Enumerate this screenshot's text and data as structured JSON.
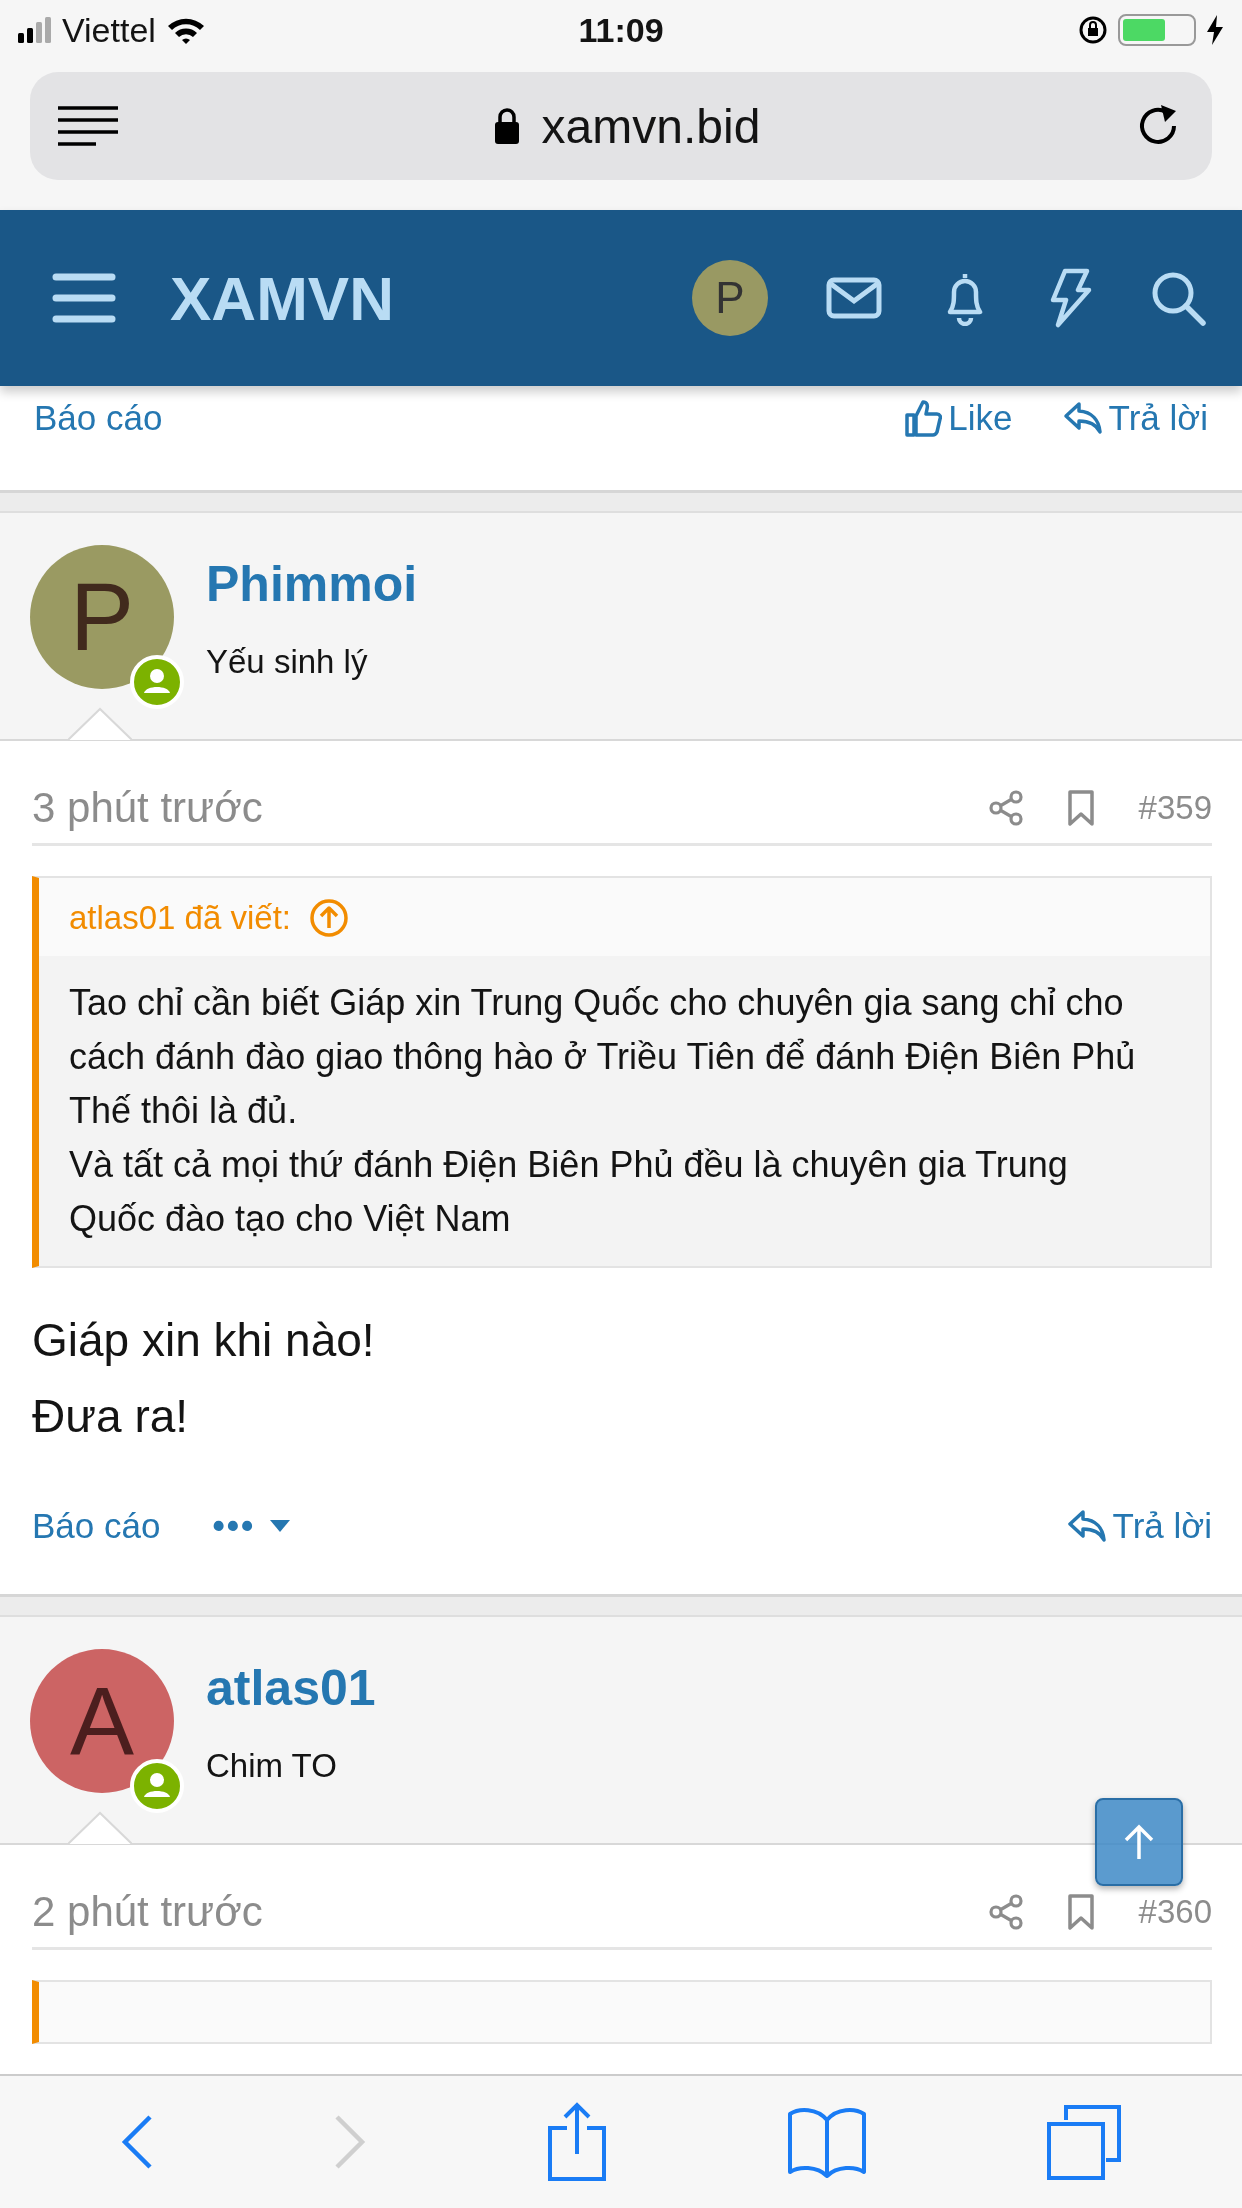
{
  "status_bar": {
    "carrier": "Viettel",
    "time": "11:09"
  },
  "browser": {
    "url": "xamvn.bid"
  },
  "site_header": {
    "logo": "XAMVN",
    "avatar_letter": "P"
  },
  "prev_post_actions": {
    "report": "Báo cáo",
    "like": "Like",
    "reply": "Trả lời"
  },
  "posts": [
    {
      "author": "Phimmoi",
      "user_title": "Yếu sinh lý",
      "avatar_letter": "P",
      "color": "#9a9a62",
      "online": true,
      "time": "3 phút trước",
      "number": "#359",
      "quote": {
        "author_line": "atlas01 đã viết:",
        "lines": [
          "Tao chỉ cần biết Giáp xin Trung Quốc cho chuyên gia sang chỉ cho cách đánh đào giao thông hào ở Triều Tiên để đánh Điện Biên Phủ",
          "Thế thôi là đủ.",
          "Và tất cả mọi thứ đánh Điện Biên Phủ đều là chuyên gia Trung Quốc đào tạo cho Việt Nam"
        ]
      },
      "body": [
        "Giáp xin khi nào!",
        "Đưa ra!"
      ],
      "actions": {
        "report": "Báo cáo",
        "more": "•••",
        "reply": "Trả lời"
      }
    },
    {
      "author": "atlas01",
      "user_title": "Chim TO",
      "avatar_letter": "A",
      "color": "#cc6464",
      "online": true,
      "time": "2 phút trước",
      "number": "#360",
      "quote_box": true
    }
  ]
}
